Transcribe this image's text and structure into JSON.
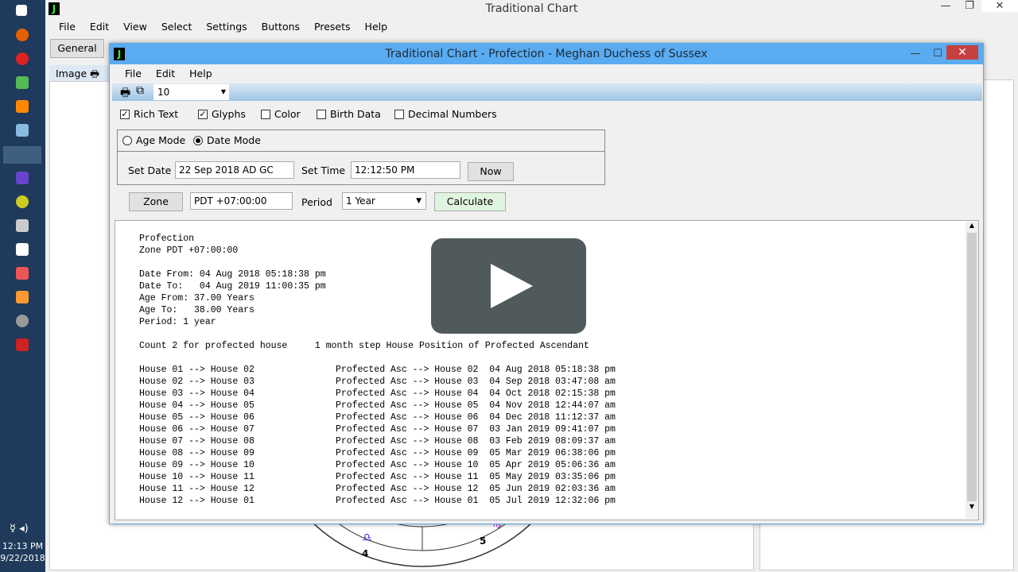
{
  "taskbar": {
    "time": "12:13 PM",
    "date": "9/22/2018"
  },
  "main_window": {
    "title": "Traditional Chart",
    "menu": [
      "File",
      "Edit",
      "View",
      "Select",
      "Settings",
      "Buttons",
      "Presets",
      "Help"
    ],
    "tab_general": "General",
    "image_label": "Image",
    "wheel_labels": [
      "4",
      "5"
    ]
  },
  "dialog": {
    "title": "Traditional Chart - Profection - Meghan Duchess of Sussex",
    "menu": [
      "File",
      "Edit",
      "Help"
    ],
    "toolbar_value": "10",
    "checkboxes": [
      {
        "label": "Rich Text",
        "checked": true
      },
      {
        "label": "Glyphs",
        "checked": true
      },
      {
        "label": "Color",
        "checked": false
      },
      {
        "label": "Birth Data",
        "checked": false
      },
      {
        "label": "Decimal Numbers",
        "checked": false
      }
    ],
    "modes": [
      {
        "label": "Age Mode",
        "selected": false
      },
      {
        "label": "Date Mode",
        "selected": true
      }
    ],
    "set_date_label": "Set Date",
    "set_date": "22 Sep 2018 AD GC",
    "set_time_label": "Set Time",
    "set_time": "12:12:50 PM",
    "now": "Now",
    "zone_button": "Zone",
    "zone": "PDT +07:00:00",
    "period_label": "Period",
    "period": "1 Year",
    "calculate": "Calculate"
  },
  "output": {
    "header": [
      "Profection",
      "Zone PDT +07:00:00",
      "",
      "Date From: 04 Aug 2018 05:18:38 pm",
      "Date To:   04 Aug 2019 11:00:35 pm",
      "Age From: 37.00 Years",
      "Age To:   38.00 Years",
      "Period: 1 year",
      "",
      "Count 2 for profected house     1 month step House Position of Profected Ascendant",
      ""
    ],
    "rows": [
      [
        "House 01 --> House 02",
        "Profected Asc --> House 02  04 Aug 2018 05:18:38 pm"
      ],
      [
        "House 02 --> House 03",
        "Profected Asc --> House 03  04 Sep 2018 03:47:08 am"
      ],
      [
        "House 03 --> House 04",
        "Profected Asc --> House 04  04 Oct 2018 02:15:38 pm"
      ],
      [
        "House 04 --> House 05",
        "Profected Asc --> House 05  04 Nov 2018 12:44:07 am"
      ],
      [
        "House 05 --> House 06",
        "Profected Asc --> House 06  04 Dec 2018 11:12:37 am"
      ],
      [
        "House 06 --> House 07",
        "Profected Asc --> House 07  03 Jan 2019 09:41:07 pm"
      ],
      [
        "House 07 --> House 08",
        "Profected Asc --> House 08  03 Feb 2019 08:09:37 am"
      ],
      [
        "House 08 --> House 09",
        "Profected Asc --> House 09  05 Mar 2019 06:38:06 pm"
      ],
      [
        "House 09 --> House 10",
        "Profected Asc --> House 10  05 Apr 2019 05:06:36 am"
      ],
      [
        "House 10 --> House 11",
        "Profected Asc --> House 11  05 May 2019 03:35:06 pm"
      ],
      [
        "House 11 --> House 12",
        "Profected Asc --> House 12  05 Jun 2019 02:03:36 am"
      ],
      [
        "House 12 --> House 01",
        "Profected Asc --> House 01  05 Jul 2019 12:32:06 pm"
      ]
    ]
  }
}
